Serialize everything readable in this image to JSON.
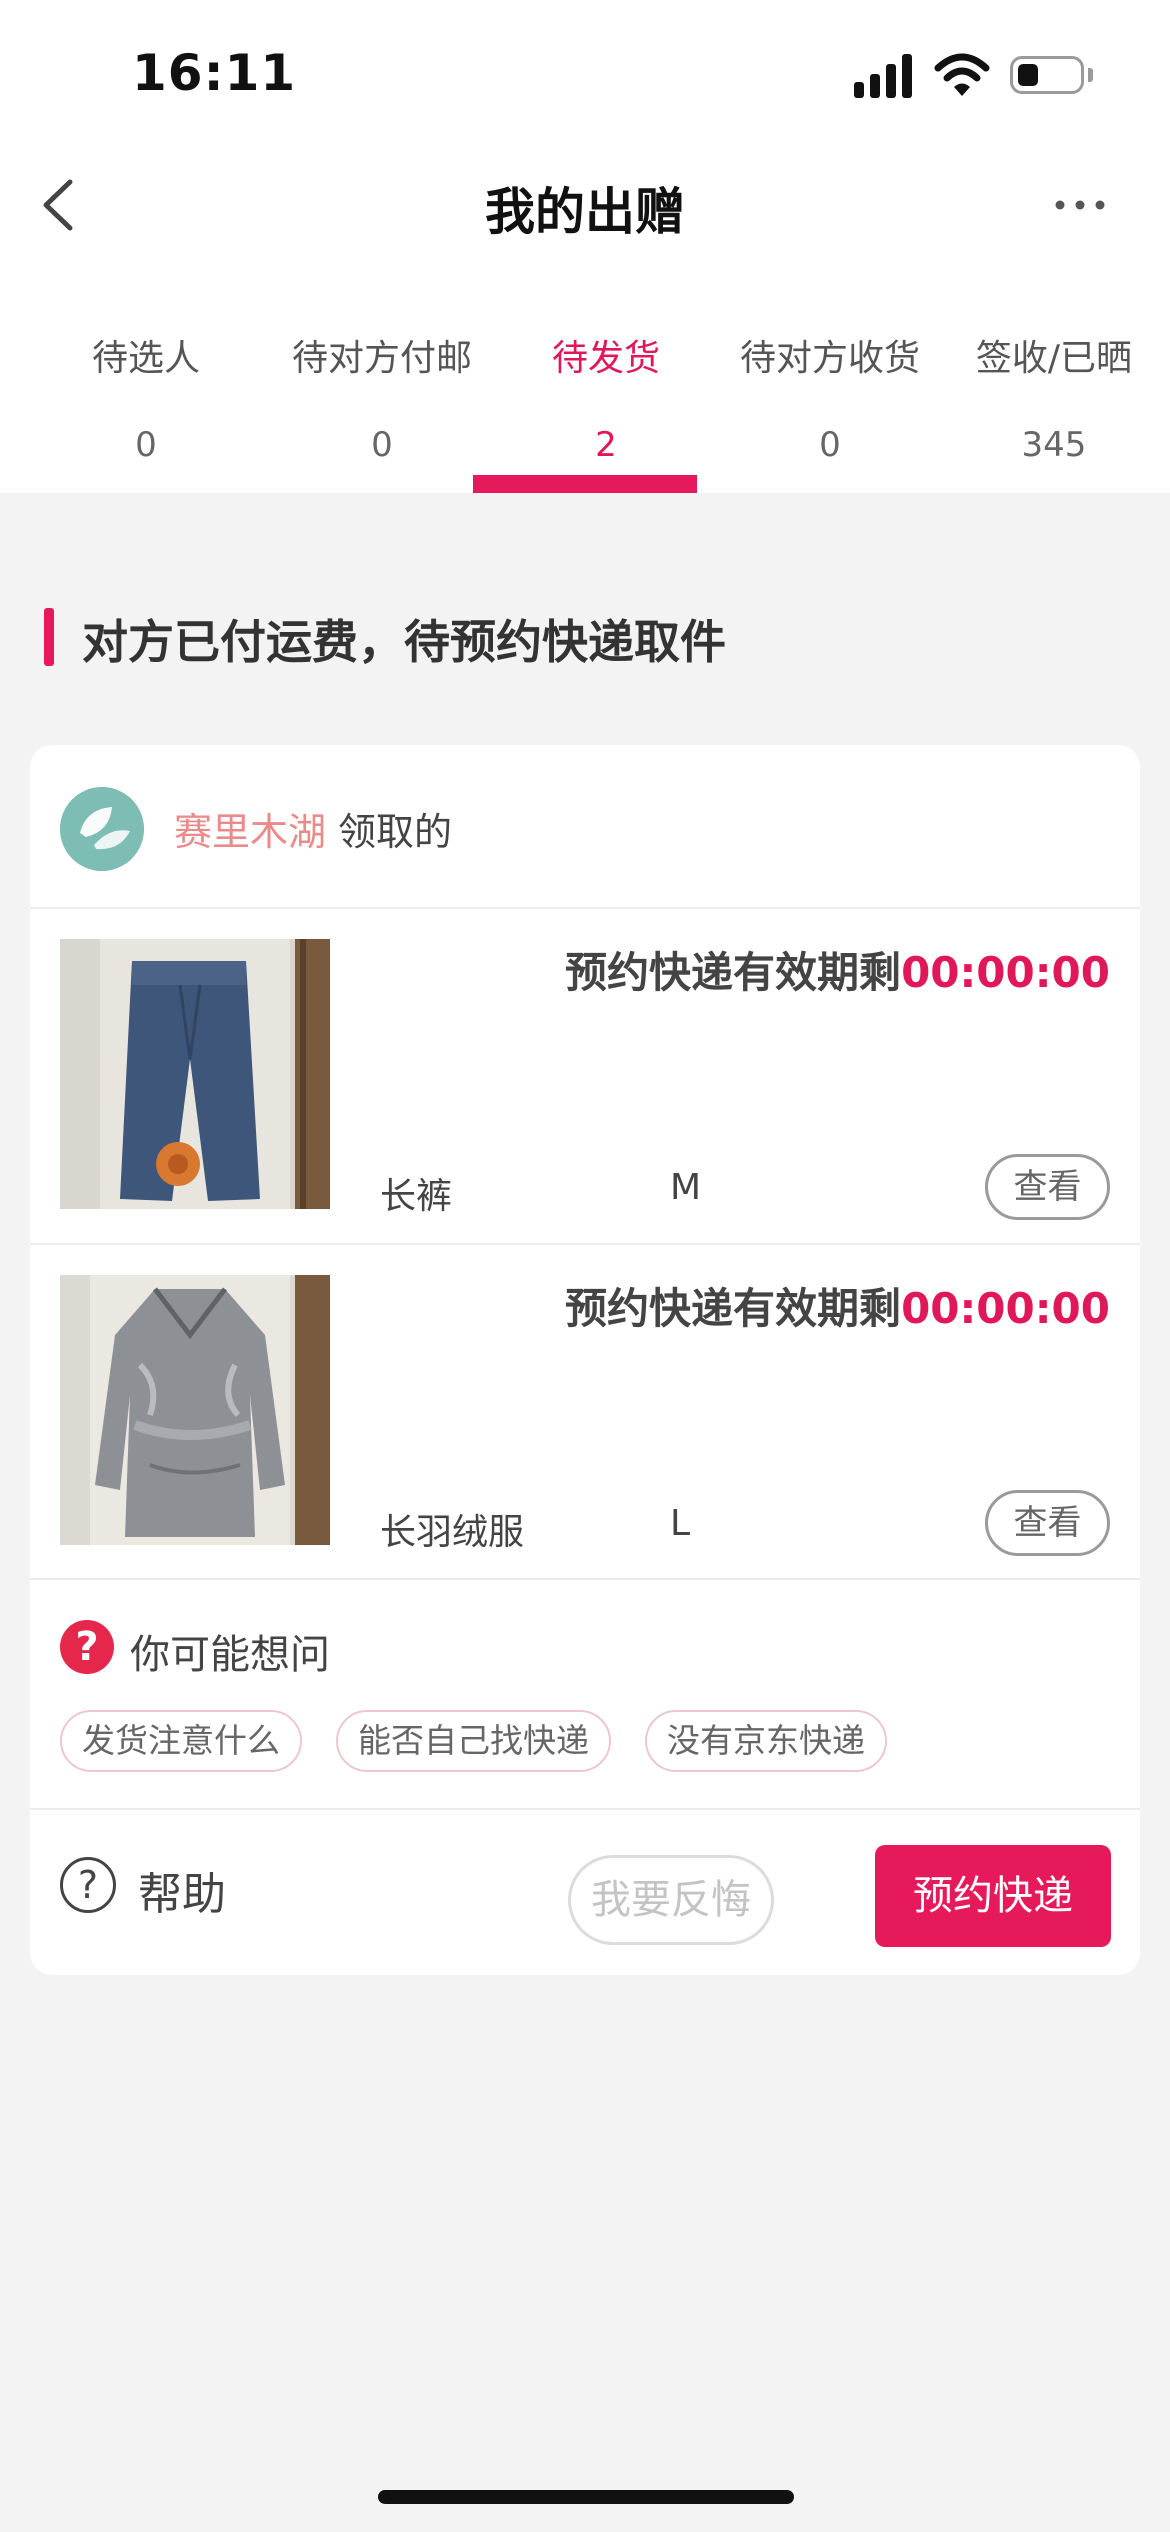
{
  "status_bar": {
    "time": "16:11"
  },
  "nav": {
    "title": "我的出赠"
  },
  "tabs": [
    {
      "label": "待选人",
      "count": "0"
    },
    {
      "label": "待对方付邮",
      "count": "0"
    },
    {
      "label": "待发货",
      "count": "2",
      "active": true
    },
    {
      "label": "待对方收货",
      "count": "0"
    },
    {
      "label": "签收/已晒",
      "count": "345"
    }
  ],
  "section": {
    "title": "对方已付运费，待预约快递取件"
  },
  "card": {
    "receiver_name": "赛里木湖",
    "receiver_suffix": "领取的",
    "items": [
      {
        "deadline_label": "预约快递有效期剩",
        "timer": "00:00:00",
        "name": "长裤",
        "size": "M",
        "view_label": "查看"
      },
      {
        "deadline_label": "预约快递有效期剩",
        "timer": "00:00:00",
        "name": "长羽绒服",
        "size": "L",
        "view_label": "查看"
      }
    ],
    "faq": {
      "icon": "?",
      "title": "你可能想问",
      "chips": [
        "发货注意什么",
        "能否自己找快递",
        "没有京东快递"
      ]
    },
    "actions": {
      "help_icon": "?",
      "help_label": "帮助",
      "regret_label": "我要反悔",
      "book_label": "预约快递"
    }
  },
  "colors": {
    "accent": "#e6195b",
    "receiver_name": "#eb8a8a",
    "background": "#f3f3f3"
  }
}
